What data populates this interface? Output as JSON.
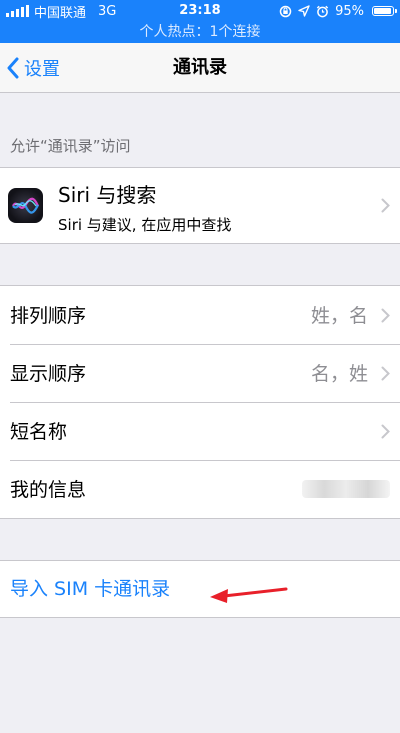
{
  "status_bar": {
    "carrier": "中国联通",
    "network": "3G",
    "time": "23:18",
    "battery": "95%",
    "battery_level": 0.95,
    "icons": [
      "signal-bars-icon",
      "rotation-lock-icon",
      "location-arrow-icon",
      "alarm-icon",
      "battery-icon"
    ]
  },
  "hotspot_bar": {
    "text": "个人热点：1个连接"
  },
  "nav": {
    "back_label": "设置",
    "title": "通讯录"
  },
  "section": {
    "header": "允许“通讯录”访问"
  },
  "siri": {
    "title": "Siri 与搜索",
    "subtitle": "Siri 与建议, 在应用中查找",
    "icon": "siri-icon"
  },
  "settings_rows": [
    {
      "label": "排列顺序",
      "value": "姓，名"
    },
    {
      "label": "显示顺序",
      "value": "名，姓"
    },
    {
      "label": "短名称",
      "value": ""
    },
    {
      "label": "我的信息",
      "value": ""
    }
  ],
  "import": {
    "label": "导入 SIM 卡通讯录"
  },
  "colors": {
    "accent": "#1a82fb",
    "background": "#efeff4",
    "separator": "#c8c7cc",
    "secondary_text": "#8e8e93",
    "annotation_arrow": "#e8202a"
  }
}
